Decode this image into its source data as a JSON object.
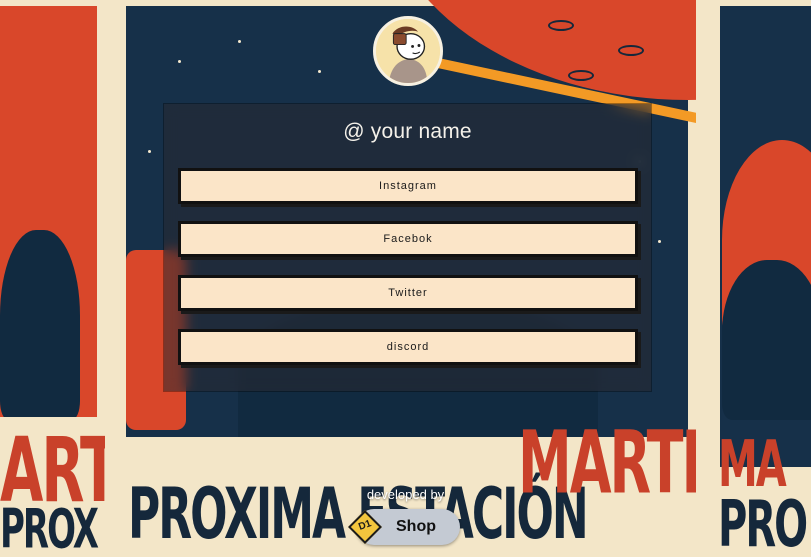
{
  "profile": {
    "name": "@ your name"
  },
  "links": [
    {
      "label": "Instagram"
    },
    {
      "label": "Facebok"
    },
    {
      "label": "Twitter"
    },
    {
      "label": "discord"
    }
  ],
  "footer": {
    "developer_text": "developed by",
    "shop_label": "Shop",
    "logo_text": "D1"
  },
  "background": {
    "poster_words": [
      "PROXIMA ESTACIÓN",
      "MARTE"
    ]
  },
  "colors": {
    "button_bg": "#fbe5c8",
    "card_overlay": "#28283a",
    "sky": "#163049",
    "planet": "#d9472a"
  },
  "icons": [
    "avatar-image",
    "d1-logo-icon"
  ]
}
